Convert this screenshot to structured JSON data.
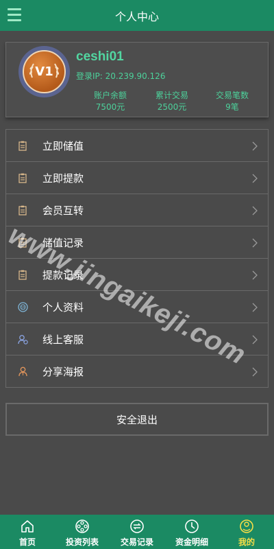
{
  "header": {
    "title": "个人中心"
  },
  "profile": {
    "badge": "V1",
    "username": "ceshi01",
    "ip_label": "登录IP:",
    "ip_value": "20.239.90.126",
    "stats": [
      {
        "label": "账户余额",
        "value": "7500元"
      },
      {
        "label": "累计交易",
        "value": "2500元"
      },
      {
        "label": "交易笔数",
        "value": "9笔"
      }
    ]
  },
  "menu": [
    {
      "label": "立即储值",
      "icon": "clipboard-icon"
    },
    {
      "label": "立即提款",
      "icon": "clipboard-icon"
    },
    {
      "label": "会员互转",
      "icon": "clipboard-icon"
    },
    {
      "label": "储值记录",
      "icon": "clipboard-icon"
    },
    {
      "label": "提款记录",
      "icon": "clipboard-icon"
    },
    {
      "label": "个人资料",
      "icon": "profile-circle-icon"
    },
    {
      "label": "线上客服",
      "icon": "customer-service-icon"
    },
    {
      "label": "分享海报",
      "icon": "person-outline-icon"
    }
  ],
  "logout_label": "安全退出",
  "watermark": "www.jingaikeji.com",
  "tabs": [
    {
      "label": "首页",
      "icon": "home-icon"
    },
    {
      "label": "投资列表",
      "icon": "film-reel-icon"
    },
    {
      "label": "交易记录",
      "icon": "exchange-icon"
    },
    {
      "label": "资金明细",
      "icon": "clock-icon"
    },
    {
      "label": "我的",
      "icon": "user-smile-icon"
    }
  ],
  "colors": {
    "header_bg": "#1b8a63",
    "accent_green": "#4dd19b",
    "active_tab": "#f7de47",
    "page_bg": "#4a4a4a"
  }
}
